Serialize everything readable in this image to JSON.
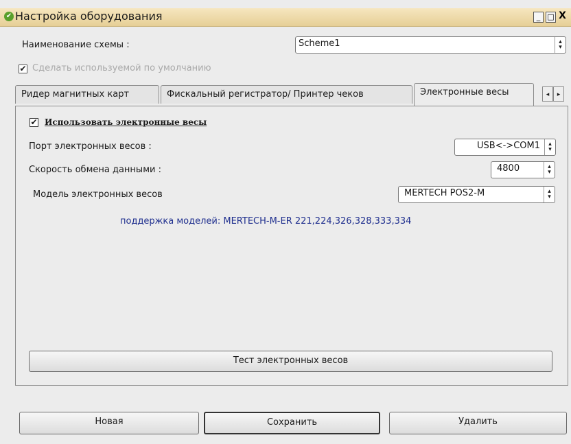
{
  "window": {
    "title": "Настройка оборудования",
    "min": "_",
    "max": "□",
    "close": "X"
  },
  "scheme": {
    "label": "Наименование схемы :",
    "value": "Scheme1"
  },
  "default_checkbox": {
    "label": "Сделать используемой по умолчанию",
    "checked": true
  },
  "tabs": [
    {
      "label": "Ридер магнитных карт"
    },
    {
      "label": "Фискальный регистратор/ Принтер чеков"
    },
    {
      "label": "Электронные весы"
    }
  ],
  "tab_scroll": {
    "left": "◂",
    "right": "▸"
  },
  "scales": {
    "use_label": "Использовать электронные весы",
    "port_label": "Порт электронных весов :",
    "port_value": "USB<->COM1",
    "speed_label": "Скорость обмена данными :",
    "speed_value": "4800",
    "model_label": "Модель электронных весов",
    "model_value": "MERTECH POS2-M",
    "support_text": "поддержка моделей: MERTECH-M-ER 221,224,326,328,333,334",
    "test_button": "Тест электронных весов"
  },
  "buttons": {
    "new": "Новая",
    "save": "Сохранить",
    "delete": "Удалить"
  },
  "icons": {
    "check": "✔",
    "arrows": "▴▾"
  }
}
